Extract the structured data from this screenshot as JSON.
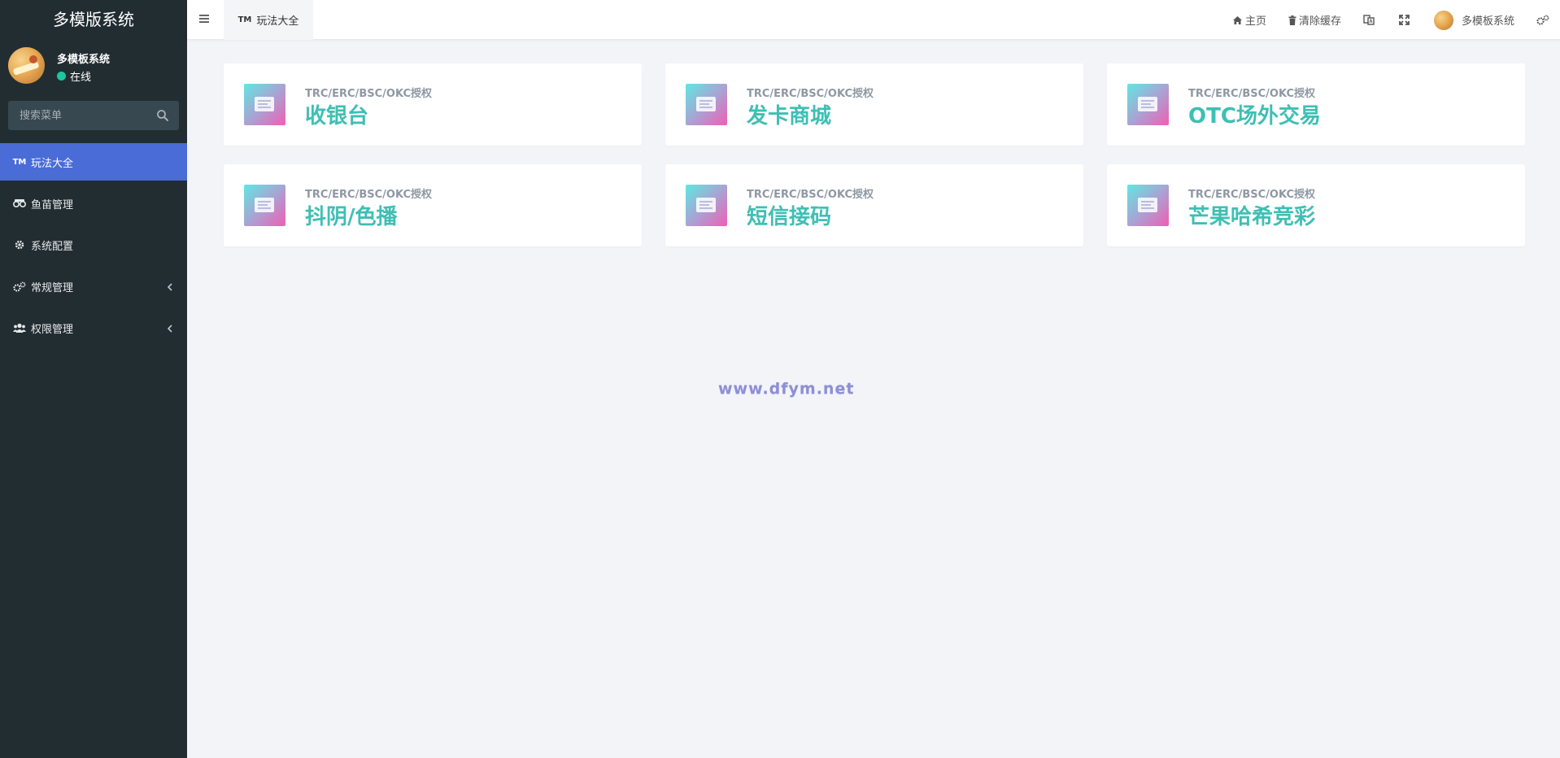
{
  "sidebar": {
    "brand": "多模版系统",
    "user": {
      "name": "多模板系统",
      "status": "在线"
    },
    "search": {
      "placeholder": "搜索菜单"
    },
    "menu": [
      {
        "icon": "TM",
        "label": "玩法大全",
        "active": true
      },
      {
        "icon": "binoculars-icon",
        "label": "鱼苗管理"
      },
      {
        "icon": "gear-icon",
        "label": "系统配置"
      },
      {
        "icon": "gears-icon",
        "label": "常规管理",
        "expandable": true
      },
      {
        "icon": "users-icon",
        "label": "权限管理",
        "expandable": true
      }
    ]
  },
  "topbar": {
    "tab": {
      "icon": "TM",
      "label": "玩法大全"
    },
    "home": "主页",
    "clear_cache": "清除缓存",
    "username": "多模板系统"
  },
  "cards": [
    {
      "subtitle": "TRC/ERC/BSC/OKC授权",
      "title": "收银台"
    },
    {
      "subtitle": "TRC/ERC/BSC/OKC授权",
      "title": "发卡商城"
    },
    {
      "subtitle": "TRC/ERC/BSC/OKC授权",
      "title": "OTC场外交易"
    },
    {
      "subtitle": "TRC/ERC/BSC/OKC授权",
      "title": "抖阴/色播"
    },
    {
      "subtitle": "TRC/ERC/BSC/OKC授权",
      "title": "短信接码"
    },
    {
      "subtitle": "TRC/ERC/BSC/OKC授权",
      "title": "芒果哈希竞彩"
    }
  ],
  "watermark": "www.dfym.net",
  "colors": {
    "sidebar": "#222d32",
    "active_menu": "#4a6cd7",
    "card_title": "#3ebfb4",
    "status_online": "#1cc6a0"
  }
}
